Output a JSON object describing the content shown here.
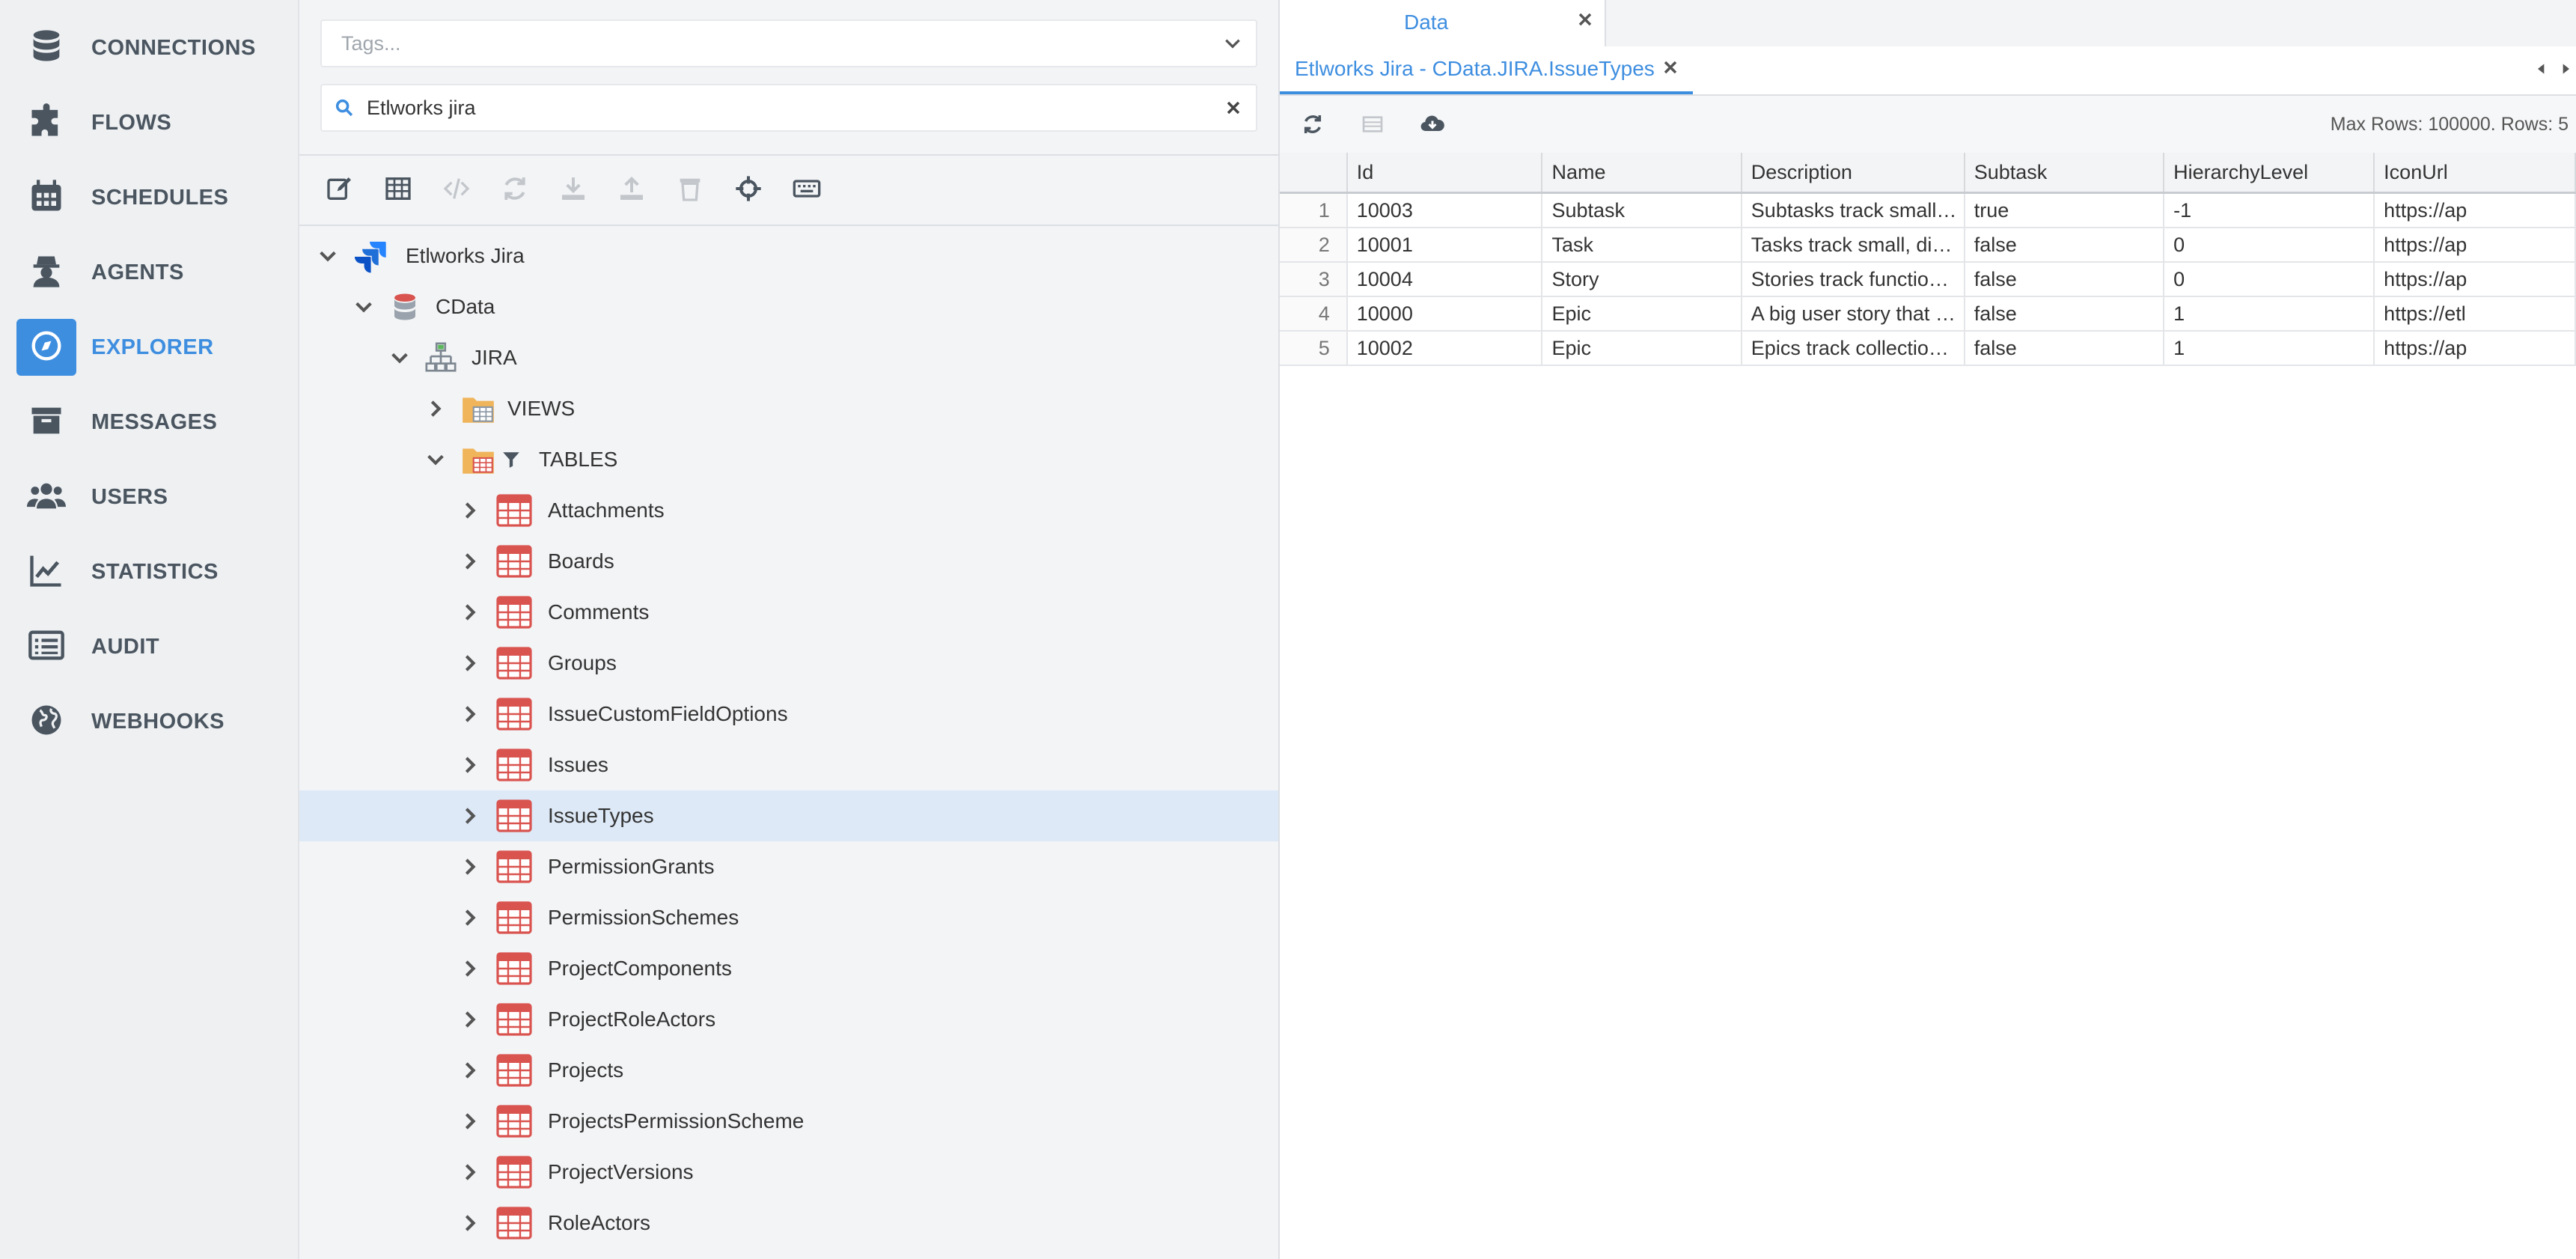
{
  "sidebar": {
    "items": [
      {
        "label": "CONNECTIONS",
        "icon": "database-icon"
      },
      {
        "label": "FLOWS",
        "icon": "puzzle-icon"
      },
      {
        "label": "SCHEDULES",
        "icon": "calendar-icon"
      },
      {
        "label": "AGENTS",
        "icon": "agent-icon"
      },
      {
        "label": "EXPLORER",
        "icon": "compass-icon",
        "active": true
      },
      {
        "label": "MESSAGES",
        "icon": "archive-icon"
      },
      {
        "label": "USERS",
        "icon": "users-icon"
      },
      {
        "label": "STATISTICS",
        "icon": "chart-icon"
      },
      {
        "label": "AUDIT",
        "icon": "list-icon"
      },
      {
        "label": "WEBHOOKS",
        "icon": "globe-icon"
      }
    ]
  },
  "explorer": {
    "tags_placeholder": "Tags...",
    "search_value": "Etlworks jira",
    "tree": {
      "root": "Etlworks Jira",
      "database": "CData",
      "schema": "JIRA",
      "views_label": "VIEWS",
      "tables_label": "TABLES",
      "tables": [
        "Attachments",
        "Boards",
        "Comments",
        "Groups",
        "IssueCustomFieldOptions",
        "Issues",
        "IssueTypes",
        "PermissionGrants",
        "PermissionSchemes",
        "ProjectComponents",
        "ProjectRoleActors",
        "Projects",
        "ProjectsPermissionScheme",
        "ProjectVersions",
        "RoleActors"
      ],
      "selected_table": "IssueTypes"
    }
  },
  "data_panel": {
    "outer_tab": "Data",
    "inner_tab": "Etlworks Jira - CData.JIRA.IssueTypes",
    "max_rows_text": "Max Rows: 100000. Rows: 5",
    "columns": [
      "Id",
      "Name",
      "Description",
      "Subtask",
      "HierarchyLevel",
      "IconUrl"
    ],
    "rows": [
      {
        "n": "1",
        "Id": "10003",
        "Name": "Subtask",
        "Description": "Subtasks track small…",
        "Subtask": "true",
        "HierarchyLevel": "-1",
        "IconUrl": "https://ap"
      },
      {
        "n": "2",
        "Id": "10001",
        "Name": "Task",
        "Description": "Tasks track small, di…",
        "Subtask": "false",
        "HierarchyLevel": "0",
        "IconUrl": "https://ap"
      },
      {
        "n": "3",
        "Id": "10004",
        "Name": "Story",
        "Description": "Stories track functio…",
        "Subtask": "false",
        "HierarchyLevel": "0",
        "IconUrl": "https://ap"
      },
      {
        "n": "4",
        "Id": "10000",
        "Name": "Epic",
        "Description": "A big user story that …",
        "Subtask": "false",
        "HierarchyLevel": "1",
        "IconUrl": "https://etl"
      },
      {
        "n": "5",
        "Id": "10002",
        "Name": "Epic",
        "Description": "Epics track collectio…",
        "Subtask": "false",
        "HierarchyLevel": "1",
        "IconUrl": "https://ap"
      }
    ]
  },
  "colors": {
    "accent": "#3e8ee0",
    "selected_row": "#dde9f7",
    "table_icon": "#d9534f",
    "folder": "#f0b45a"
  }
}
